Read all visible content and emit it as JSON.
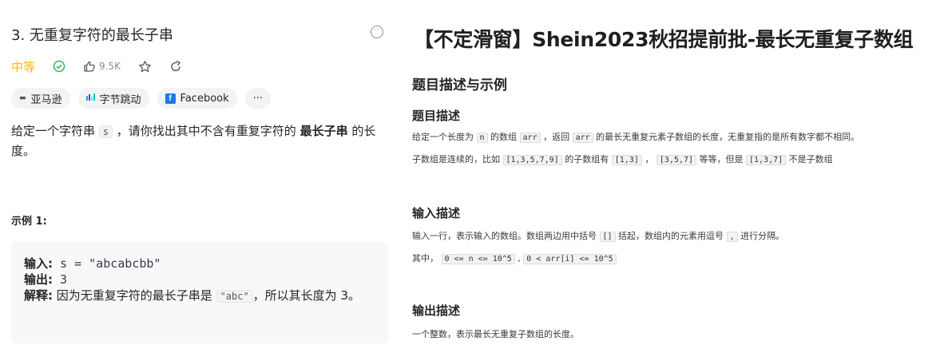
{
  "left": {
    "title": "3. 无重复字符的最长子串",
    "more_icon": "ellipsis-circle-icon",
    "difficulty": "中等",
    "likes": "9.5K",
    "tags": [
      {
        "label": "亚马逊",
        "icon": "amazon-logo-icon"
      },
      {
        "label": "字节跳动",
        "icon": "bytedance-logo-icon"
      },
      {
        "label": "Facebook",
        "icon": "facebook-logo-icon"
      }
    ],
    "more_tags": "···",
    "desc_part1": "给定一个字符串 ",
    "desc_code": "s",
    "desc_part2": " ，请你找出其中不含有重复字符的 ",
    "desc_bold": "最长子串",
    "desc_part3": " 的长度。",
    "example_heading": "示例 1:",
    "example": {
      "input_label": "输入:",
      "input_value": " s = \"abcabcbb\"",
      "output_label": "输出:",
      "output_value": " 3",
      "explain_label": "解释:",
      "explain_text1": " 因为无重复字符的最长子串是 ",
      "explain_code": "\"abc\"",
      "explain_text2": "，所以其长度为 3。"
    }
  },
  "right": {
    "title": "【不定滑窗】Shein2023秋招提前批-最长无重复子数组",
    "section_heading": "题目描述与示例",
    "desc_heading": "题目描述",
    "desc_line1": {
      "t1": "给定一个长度为 ",
      "c1": "n",
      "t2": " 的数组 ",
      "c2": "arr",
      "t3": " ，返回 ",
      "c3": "arr",
      "t4": " 的最长无重复元素子数组的长度，无重复指的是所有数字都不相同。"
    },
    "desc_line2": {
      "t1": "子数组是连续的，比如 ",
      "c1": "[1,3,5,7,9]",
      "t2": " 的子数组有 ",
      "c2": "[1,3]",
      "t3": " ， ",
      "c3": "[3,5,7]",
      "t4": " 等等，但是 ",
      "c4": "[1,3,7]",
      "t5": " 不是子数组"
    },
    "input_heading": "输入描述",
    "input_line1": {
      "t1": "输入一行，表示输入的数组。数组两边用中括号 ",
      "c1": "[]",
      "t2": " 括起，数组内的元素用逗号 ",
      "c2": ",",
      "t3": " 进行分隔。"
    },
    "input_line2": {
      "t1": "其中， ",
      "c1": "0 <= n <= 10^5",
      "t2": " , ",
      "c2": "0 < arr[i] <= 10^5"
    },
    "output_heading": "输出描述",
    "output_line": "一个整数，表示最长无重复子数组的长度。"
  }
}
